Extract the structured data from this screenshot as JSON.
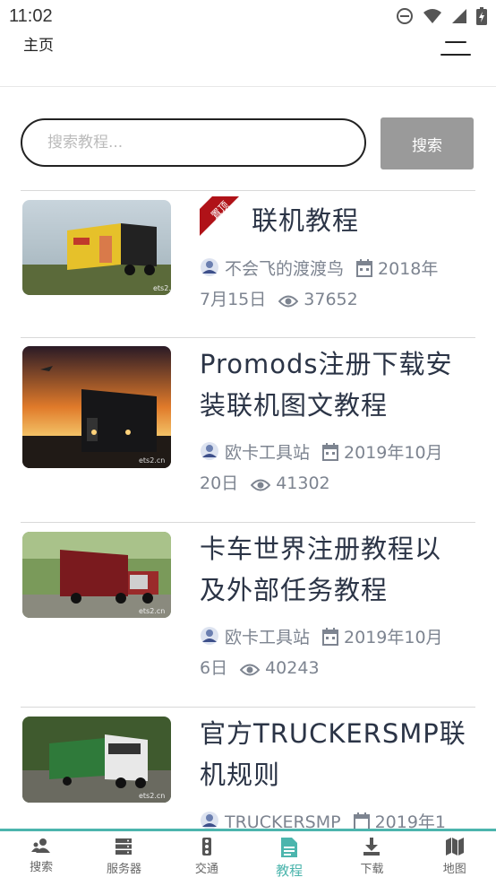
{
  "status_bar": {
    "time": "11:02"
  },
  "header": {
    "title": "主页"
  },
  "search": {
    "placeholder": "搜索教程...",
    "button_label": "搜索"
  },
  "posts": [
    {
      "title": "联机教程",
      "author": "不会飞的渡渡鸟",
      "date_line1": "2018年",
      "date_line2": "7月15日",
      "views": "37652",
      "pinned": true,
      "badge": "置顶"
    },
    {
      "title_line1": "Promods注册下载安",
      "title_line2": "装联机图文教程",
      "author": "欧卡工具站",
      "date_line1": "2019年10月",
      "date_line2": "20日",
      "views": "41302"
    },
    {
      "title_line1": "卡车世界注册教程以",
      "title_line2": "及外部任务教程",
      "author": "欧卡工具站",
      "date_line1": "2019年10月",
      "date_line2": "6日",
      "views": "40243"
    },
    {
      "title_line1": "官方TRUCKERSMP联",
      "title_line2": "机规则",
      "author": "TRUCKERSMP",
      "date_line1": "2019年1"
    }
  ],
  "watermark": "ets2.cn",
  "bottom_nav": [
    {
      "label": "搜索",
      "icon": "users-icon"
    },
    {
      "label": "服务器",
      "icon": "server-icon"
    },
    {
      "label": "交通",
      "icon": "traffic-light-icon"
    },
    {
      "label": "教程",
      "icon": "document-icon",
      "active": true
    },
    {
      "label": "下载",
      "icon": "download-icon"
    },
    {
      "label": "地图",
      "icon": "map-icon"
    }
  ],
  "colors": {
    "accent": "#4cb5ad",
    "title": "#2b3446",
    "meta": "#7d8490",
    "button": "#9a9a9a",
    "badge": "#b01218"
  }
}
